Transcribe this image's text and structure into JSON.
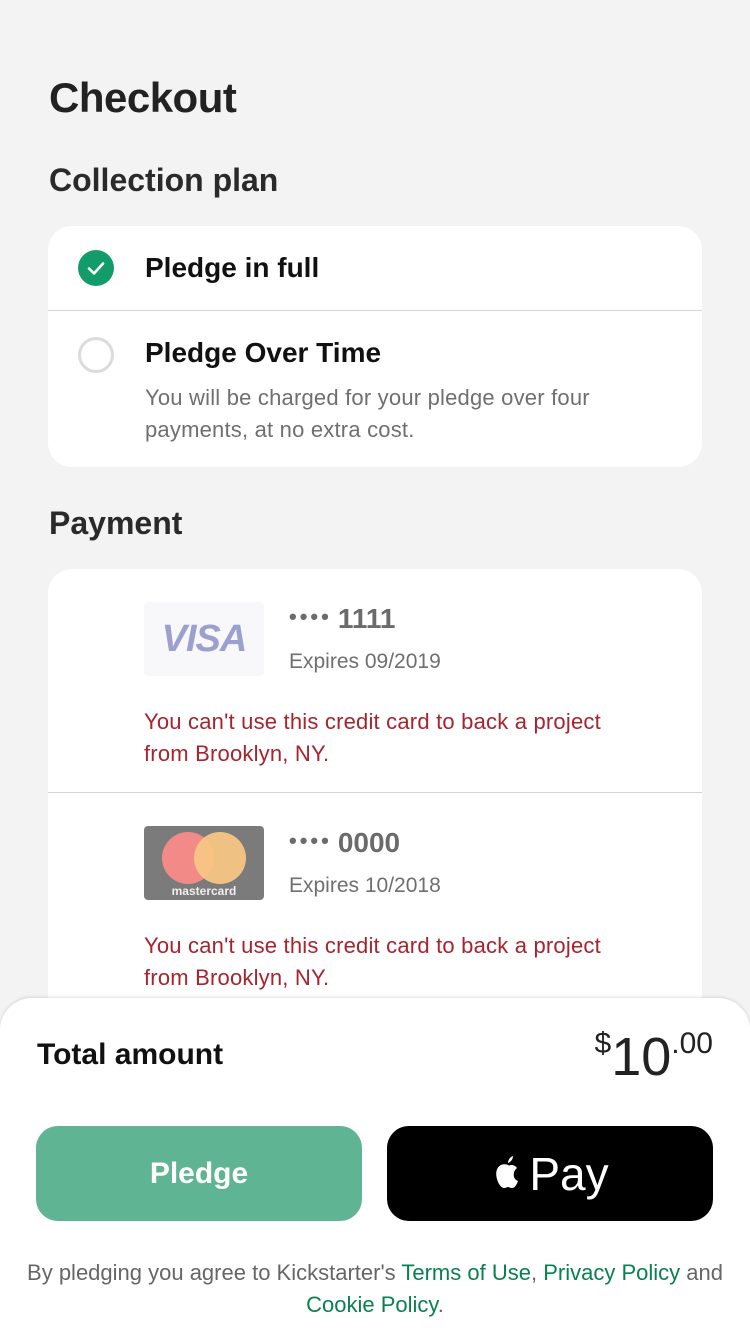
{
  "header": {
    "title": "Checkout"
  },
  "collection_plan": {
    "heading": "Collection plan",
    "options": [
      {
        "label": "Pledge in full",
        "selected": true
      },
      {
        "label": "Pledge Over Time",
        "selected": false,
        "description_line1": "You will be charged for your pledge over four",
        "description_line2": "payments, at no extra cost."
      }
    ]
  },
  "payment": {
    "heading": "Payment",
    "cards": [
      {
        "brand": "VISA",
        "dots": "••••",
        "last4": "1111",
        "expires": "Expires 09/2019",
        "error_line1": "You can't use this credit card to back a project",
        "error_line2": "from Brooklyn, NY."
      },
      {
        "brand": "mastercard",
        "dots": "••••",
        "last4": "0000",
        "expires": "Expires 10/2018",
        "error_line1": "You can't use this credit card to back a project",
        "error_line2": "from Brooklyn, NY."
      }
    ]
  },
  "footer": {
    "total_label": "Total amount",
    "currency": "$",
    "amount_major": "10",
    "amount_minor": ".00",
    "pledge_button": "Pledge",
    "apple_pay_label": "Pay",
    "legal_prefix": "By pledging you agree to Kickstarter's ",
    "terms_link": "Terms of Use",
    "sep1": ", ",
    "privacy_link": "Privacy Policy",
    "sep2": " and ",
    "cookie_link": "Cookie Policy",
    "suffix": "."
  },
  "colors": {
    "accent": "#129c69",
    "pledge_button": "#5fb494",
    "error": "#a8232e",
    "link": "#0a8050"
  }
}
